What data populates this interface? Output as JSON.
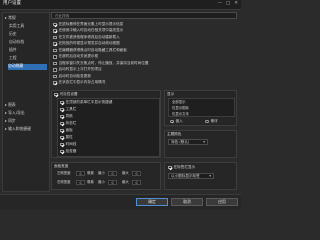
{
  "window": {
    "title": "用户设置",
    "minimize_glyph": "—",
    "maximize_glyph": "□",
    "close_glyph": "✕"
  },
  "sidebar": {
    "items": [
      {
        "label": "▸ 常规"
      },
      {
        "label": "实用工具"
      },
      {
        "label": "历史"
      },
      {
        "label": "自动存档"
      },
      {
        "label": "插件"
      },
      {
        "label": "工程"
      },
      {
        "label": "自动隐藏"
      },
      {
        "label": "▸ 图表"
      },
      {
        "label": "▸ 导入/导出"
      },
      {
        "label": "▸ 同步"
      },
      {
        "label": "▸ 输入和快捷键"
      }
    ],
    "selected_index": 6
  },
  "search": {
    "placeholder": "在此搜索"
  },
  "options": [
    {
      "label": "在鼠标悬停在界面元素上时显示提示信息",
      "checked": true
    },
    {
      "label": "在使用中输入时自动在相关项中高亮显示",
      "checked": true
    },
    {
      "label": "在文件被其他程序修改后自动重新载入",
      "checked": false
    },
    {
      "label": "在拖放的时候显示预览并自动滚动视图",
      "checked": true
    },
    {
      "label": "在编辑器获得焦点时自动隐藏工具栏和面板",
      "checked": false
    },
    {
      "label": "在超时后自动关闭提示框",
      "checked": false
    },
    {
      "label": "当程序窗口失去焦点时，停止播放，并保持当前时间位置",
      "checked": false
    },
    {
      "label": "启动时显示上次打开的项目",
      "checked": false
    },
    {
      "label": "启动时自动检查更新",
      "checked": false
    },
    {
      "label": "在状态栏中显示内存占用情况",
      "checked": true
    }
  ],
  "group_left": {
    "title": "可见性设置",
    "checked": true,
    "items": [
      {
        "label": "在顶部的菜单栏中显示快捷键",
        "checked": true
      },
      {
        "label": "工具栏",
        "checked": true
      },
      {
        "label": "导航",
        "checked": true
      },
      {
        "label": "状态栏",
        "checked": true
      },
      {
        "label": "面板",
        "checked": true
      },
      {
        "label": "属性",
        "checked": true
      },
      {
        "label": "时间线",
        "checked": true
      },
      {
        "label": "检查器",
        "checked": true
      }
    ]
  },
  "group_right_top": {
    "title": "显示",
    "options": [
      {
        "label": "全部显示",
        "selected": false
      },
      {
        "label": "仅显示图标",
        "selected": false
      },
      {
        "label": "仅显示文本",
        "selected": true
      }
    ],
    "radios": [
      {
        "label": "嵌入",
        "selected": true
      },
      {
        "label": "悬浮",
        "selected": false
      }
    ]
  },
  "group_right_mid": {
    "title": "主题颜色",
    "select_value": "深色 (默认)",
    "arrow": "▾"
  },
  "bottom_left": {
    "title": "面板宽度",
    "rows": [
      {
        "label": "左侧宽度",
        "value": "0",
        "unit": "像素"
      },
      {
        "label": "右侧宽度",
        "value": "0",
        "unit": "像素"
      }
    ],
    "col_labels": [
      "最小",
      "最大"
    ],
    "ranges": [
      [
        "0",
        "0"
      ],
      [
        "0",
        "0"
      ]
    ]
  },
  "bottom_right": {
    "checkbox_label": "在标签栏显示",
    "checked": true,
    "select_value": "以小图标显示标签",
    "arrow": "▾"
  },
  "footer": {
    "ok": "确定",
    "cancel": "取消",
    "apply": "应用"
  },
  "colors": {
    "background": "#2b2b2b",
    "selection": "#2f6fb5",
    "accent_border": "#4f8fd6"
  }
}
